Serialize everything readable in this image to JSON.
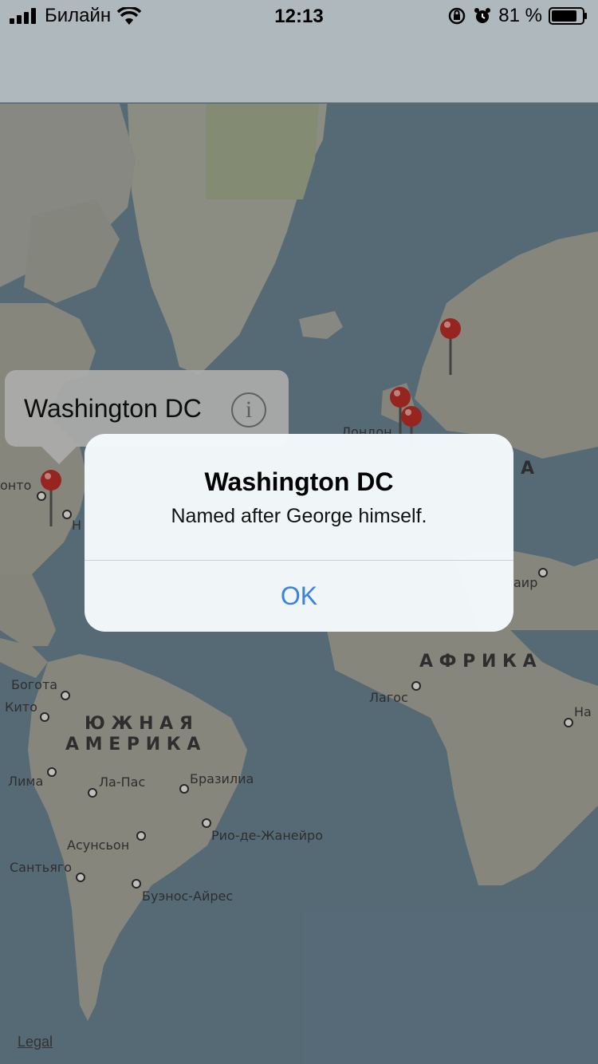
{
  "status_bar": {
    "carrier": "Билайн",
    "time": "12:13",
    "battery_percent": "81 %"
  },
  "map": {
    "callout": {
      "title": "Washington DC"
    },
    "labels": {
      "toronto": "онто",
      "n_label": "Н",
      "london": "Лондон",
      "africa_a": "А",
      "cairo": "аир",
      "africa": "А Ф Р И К А",
      "lagos": "Лагос",
      "nairobi": "На",
      "bogota": "Богота",
      "quito": "Кито",
      "south_america_1": "Ю Ж Н А Я",
      "south_america_2": "А М Е Р И К А",
      "lima": "Лима",
      "la_paz": "Ла-Пас",
      "brasilia": "Бразилиа",
      "rio": "Рио-де-Жанейро",
      "asuncion": "Асунсьон",
      "santiago": "Сантьяго",
      "buenos_aires": "Буэнос-Айрес"
    },
    "legal": "Legal"
  },
  "alert": {
    "title": "Washington DC",
    "message": "Named after George himself.",
    "ok_label": "OK"
  }
}
